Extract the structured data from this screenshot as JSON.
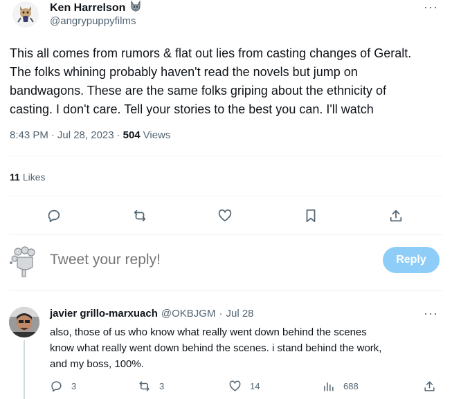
{
  "tweet": {
    "author_name": "Ken Harrelson",
    "author_emoji": "wolf-icon",
    "author_handle": "@angrypuppyfilms",
    "lines": [
      "This all comes from rumors & flat out lies from casting changes of Geralt.",
      "The folks whining probably haven't read the novels but jump on",
      "bandwagons. These are the same folks griping about the ethnicity of",
      "casting. I don't care. Tell your stories to the best you can. I'll watch"
    ],
    "time": "8:43 PM",
    "dot": "·",
    "date": "Jul 28, 2023",
    "views_count": "504",
    "views_label": "Views",
    "likes_count": "11",
    "likes_label": "Likes",
    "more": "···"
  },
  "actions": [
    "reply-icon",
    "retweet-icon",
    "like-icon",
    "bookmark-icon",
    "share-icon"
  ],
  "composer": {
    "placeholder": "Tweet your reply!",
    "button_label": "Reply"
  },
  "reply": {
    "name": "javier grillo-marxuach",
    "handle": "@OKBJGM",
    "dot": "·",
    "date": "Jul 28",
    "more": "···",
    "lines": [
      "also, those of us who know what really went down behind the scenes",
      "know what really went down behind the scenes. i stand behind the work,",
      "and my boss, 100%."
    ],
    "stats": {
      "replies": "3",
      "retweets": "3",
      "likes": "14",
      "views": "688"
    }
  },
  "colors": {
    "text": "#0f1419",
    "secondary": "#536471",
    "reply_button": "#8ecdf8",
    "divider": "#eff3f4"
  }
}
